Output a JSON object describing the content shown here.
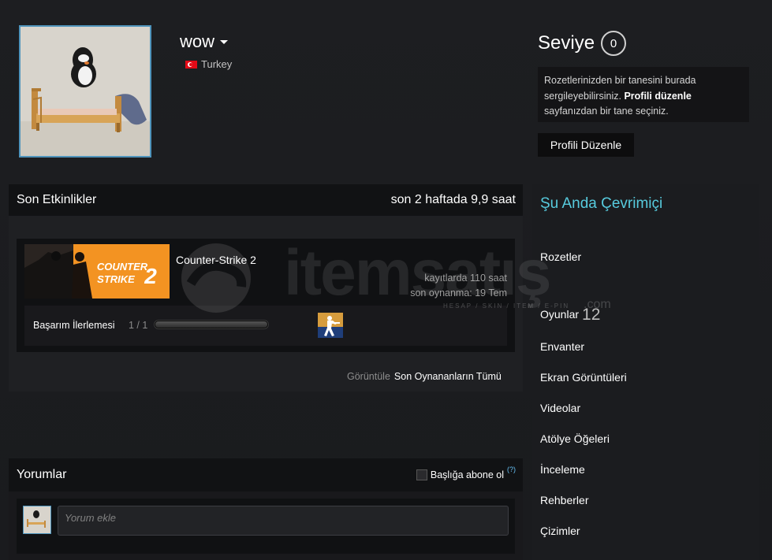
{
  "profile": {
    "persona_name": "wow",
    "country": "Turkey",
    "avatar_icon": "pingu-bed-avatar-icon"
  },
  "level": {
    "label": "Seviye",
    "value": "0",
    "badge_text_pre": "Rozetlerinizden bir tanesini burada sergileyebilirsiniz.",
    "badge_text_link": "Profili düzenle",
    "badge_text_post": "sayfanızdan bir tane seçiniz.",
    "edit_button": "Profili Düzenle"
  },
  "recent_activity": {
    "title": "Son Etkinlikler",
    "summary": "son 2 haftada 9,9 saat",
    "game": {
      "name": "Counter-Strike 2",
      "capsule_line1": "COUNTER",
      "capsule_line2": "STRIKE",
      "capsule_num": "2",
      "hours_on_record": "kayıtlarda 110 saat",
      "last_played": "son oynanma: 19 Tem",
      "achievement_label": "Başarım İlerlemesi",
      "achievement_count": "1 / 1",
      "achievement_progress": 1.0
    },
    "view_label": "Görüntüle",
    "view_link": "Son Oynananların Tümü"
  },
  "comments": {
    "title": "Yorumlar",
    "subscribe_label": "Başlığa abone ol",
    "help": "(?)",
    "placeholder": "Yorum ekle"
  },
  "sidebar": {
    "online_status": "Şu Anda Çevrimiçi",
    "items": [
      {
        "label": "Rozetler",
        "count": ""
      },
      {
        "label": "Oyunlar",
        "count": "12"
      },
      {
        "label": "Envanter",
        "count": ""
      },
      {
        "label": "Ekran Görüntüleri",
        "count": ""
      },
      {
        "label": "Videolar",
        "count": ""
      },
      {
        "label": "Atölye Öğeleri",
        "count": ""
      },
      {
        "label": "İnceleme",
        "count": ""
      },
      {
        "label": "Rehberler",
        "count": ""
      },
      {
        "label": "Çizimler",
        "count": ""
      }
    ]
  },
  "watermark": {
    "brand": "itemsatış",
    "sub": "HESAP / SKIN / ITEM / E-PIN",
    "domain": ".com"
  },
  "colors": {
    "accent_online": "#57cbde",
    "avatar_border": "#4f94bc",
    "capsule_orange": "#f39322"
  }
}
